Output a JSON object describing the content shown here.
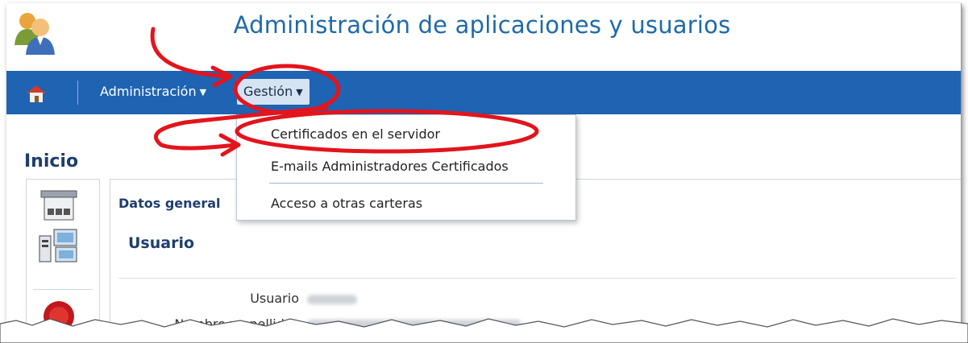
{
  "header": {
    "title": "Administración de aplicaciones y usuarios",
    "logo_icon": "users-icon"
  },
  "navbar": {
    "home_icon": "home-icon",
    "items": [
      {
        "label": "Administración",
        "has_caret": true
      },
      {
        "label": "Gestión",
        "has_caret": true,
        "active": true
      }
    ],
    "bg_color": "#1f63b3"
  },
  "gestion_menu": {
    "items": [
      {
        "label": "Certificados en el servidor",
        "highlighted": true
      },
      {
        "label": "E-mails Administradores Certificados"
      },
      {
        "label": "Acceso a otras carteras"
      }
    ]
  },
  "page": {
    "title": "Inicio"
  },
  "sidebar_icons": [
    "server-icon",
    "computers-icon",
    "certificate-seal-icon"
  ],
  "content": {
    "section_title": "Datos general",
    "subsection_title": "Usuario",
    "fields": [
      {
        "label": "Usuario",
        "value_blurred": true
      },
      {
        "label": "Nombre y apellidos",
        "value_blurred": true
      }
    ]
  },
  "annotation_color": "#e3141c"
}
